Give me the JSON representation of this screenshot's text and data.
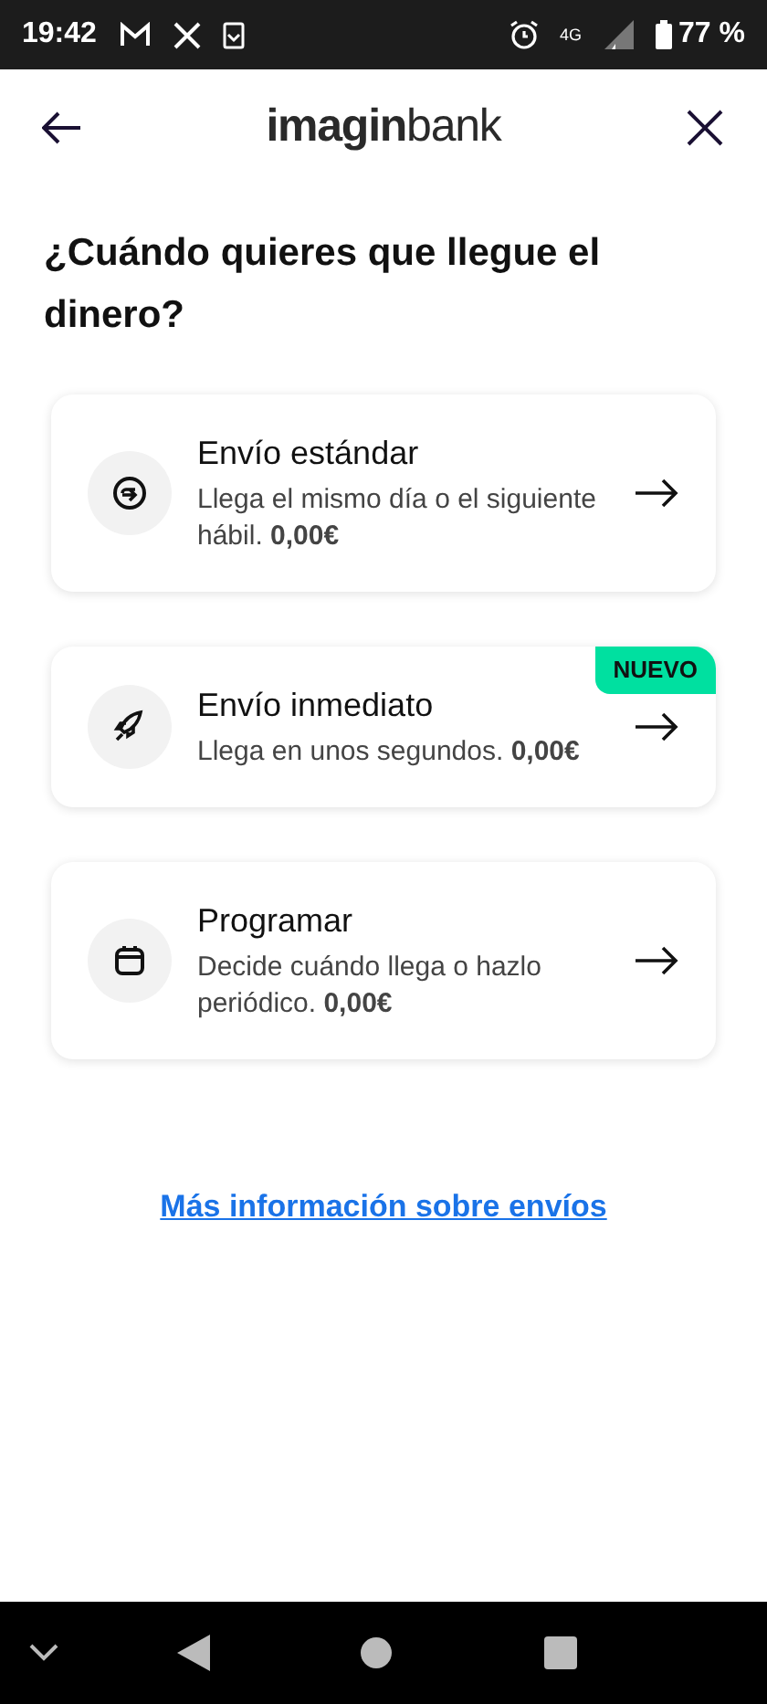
{
  "status_bar": {
    "time": "19:42",
    "network": "4G",
    "battery": "77 %"
  },
  "header": {
    "logo": "**imagin**bank"
  },
  "title": "¿Cuándo quieres que llegue el dinero?",
  "options": [
    {
      "kind": "standard",
      "title": "Envío estándar",
      "description": "Llega el mismo día o el siguiente hábil. **0,00€**"
    },
    {
      "kind": "instant",
      "title": "Envío inmediato",
      "description": "Llega en unos segundos. **0,00€**",
      "badge": "NUEVO"
    },
    {
      "kind": "schedule",
      "title": "Programar",
      "description": "Decide cuándo llega o hazlo periódico. **0,00€**"
    }
  ],
  "link": "Más información sobre envíos"
}
